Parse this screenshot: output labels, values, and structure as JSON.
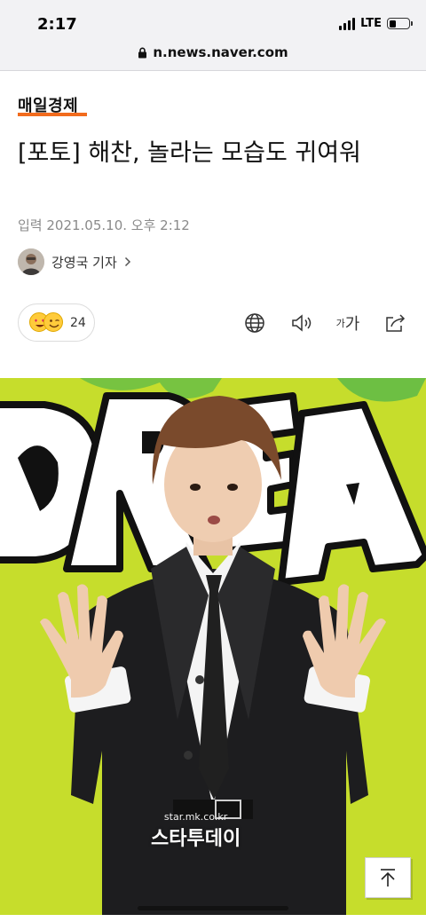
{
  "status_bar": {
    "time": "2:17",
    "network": "LTE"
  },
  "browser": {
    "url": "n.news.naver.com"
  },
  "article": {
    "press": "매일경제",
    "title": "[포토] 해찬, 놀라는 모습도 귀여워",
    "date": "입력 2021.05.10. 오후 2:12",
    "reporter": "강영국 기자"
  },
  "reaction": {
    "count": "24"
  },
  "tools": {
    "font_small": "가",
    "font_large": "가"
  },
  "photo": {
    "backdrop_text": "DREAM",
    "watermark_small": "star.mk.co.kr",
    "watermark_main": "스타투데이"
  },
  "colors": {
    "accent": "#f26b1d",
    "photo_bg": "#c6dd2c"
  },
  "icons": [
    "lock-icon",
    "globe-icon",
    "speaker-icon",
    "share-icon",
    "scroll-to-top-icon",
    "chevron-right-icon"
  ]
}
